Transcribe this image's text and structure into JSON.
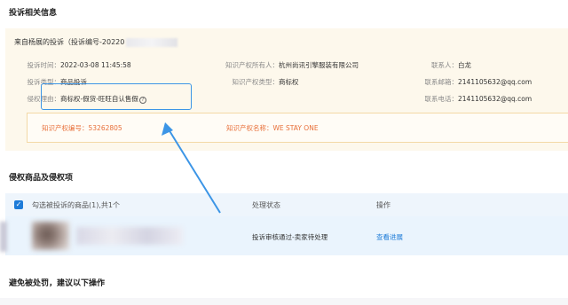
{
  "sections": {
    "complaint_info": "投诉相关信息",
    "infringing_items": "侵权商品及侵权项",
    "avoid_penalty": "避免被处罚，建议以下操作"
  },
  "complaint": {
    "source": "来自杨展的投诉（投诉编号-20220",
    "fields": {
      "time_label": "投诉时间：",
      "time_value": "2022-03-08 11:45:58",
      "type_label": "投诉类型：",
      "type_value": "商品投诉",
      "reason_label": "侵权理由：",
      "reason_value": "商标权-假货-旺旺自认售假",
      "owner_label": "知识产权所有人：",
      "owner_value": "杭州尚讯引擎服装有限公司",
      "ip_type_label": "知识产权类型：",
      "ip_type_value": "商标权",
      "contact_label": "联系人：",
      "contact_value": "白龙",
      "email_label": "联系邮箱：",
      "email_value": "2141105632@qq.com",
      "phone_label": "联系电话：",
      "phone_value": "2141105632@qq.com"
    },
    "ip": {
      "number_label": "知识产权编号：",
      "number_value": "53262805",
      "name_label": "知识产权名称：",
      "name_value": "WE STAY ONE"
    },
    "accent_color": "#e8703a",
    "highlight_color": "#3c95e6"
  },
  "table": {
    "checkbox_mark": "✓",
    "headers": {
      "selected": "勾选被投诉的商品(1),共1个",
      "status": "处理状态",
      "action": "操作"
    },
    "rows": [
      {
        "status": "投诉审核通过-卖家待处理",
        "action": "查看进展"
      }
    ]
  }
}
